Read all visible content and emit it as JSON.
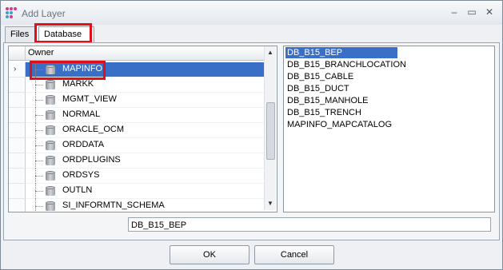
{
  "window": {
    "title": "Add Layer"
  },
  "tabs": [
    {
      "label": "Files"
    },
    {
      "label": "Database",
      "active": true
    }
  ],
  "grid": {
    "column_header": "Owner",
    "rows": [
      {
        "label": "MAPINFO",
        "selected": true
      },
      {
        "label": "MARKK"
      },
      {
        "label": "MGMT_VIEW"
      },
      {
        "label": "NORMAL"
      },
      {
        "label": "ORACLE_OCM"
      },
      {
        "label": "ORDDATA"
      },
      {
        "label": "ORDPLUGINS"
      },
      {
        "label": "ORDSYS"
      },
      {
        "label": "OUTLN"
      },
      {
        "label": "SI_INFORMTN_SCHEMA"
      }
    ]
  },
  "tables": {
    "items": [
      {
        "label": "DB_B15_BEP",
        "selected": true
      },
      {
        "label": "DB_B15_BRANCHLOCATION"
      },
      {
        "label": "DB_B15_CABLE"
      },
      {
        "label": "DB_B15_DUCT"
      },
      {
        "label": "DB_B15_MANHOLE"
      },
      {
        "label": "DB_B15_TRENCH"
      },
      {
        "label": "MAPINFO_MAPCATALOG"
      }
    ]
  },
  "name_field": {
    "value": "DB_B15_BEP"
  },
  "buttons": {
    "ok": "OK",
    "cancel": "Cancel"
  },
  "colors": {
    "highlight": "#e0101a",
    "selection": "#3a6fc8"
  }
}
